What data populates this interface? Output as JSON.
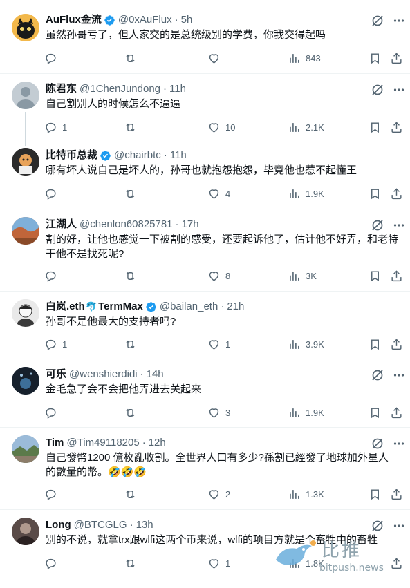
{
  "tweets": [
    {
      "name": "AuFlux金流",
      "handle": "@0xAuFlux",
      "time": "5h",
      "verified": true,
      "text": "虽然孙哥亏了，但人家交的是总统级别的学费，你我交得起吗",
      "reply": "",
      "retweet": "",
      "like": "",
      "views": "843",
      "avatar_color": "#f2b84b"
    },
    {
      "name": "陈君东",
      "handle": "@1ChenJundong",
      "time": "11h",
      "verified": false,
      "text": "自己割别人的时候怎么不逼逼",
      "reply": "1",
      "retweet": "",
      "like": "10",
      "views": "2.1K",
      "avatar_color": "#b8c4cc"
    },
    {
      "name": "比特币总裁",
      "handle": "@chairbtc",
      "time": "11h",
      "verified": true,
      "text": "哪有坏人说自己是坏人的，孙哥也就抱怨抱怨，毕竟他也惹不起懂王",
      "reply": "",
      "retweet": "",
      "like": "4",
      "views": "1.9K",
      "avatar_color": "#2a2a2a"
    },
    {
      "name": "江湖人",
      "handle": "@chenlon60825781",
      "time": "17h",
      "verified": false,
      "text": "割的好，让他也感觉一下被割的感受，还要起诉他了，估计他不好弄，和老特干他不是找死呢?",
      "reply": "",
      "retweet": "",
      "like": "8",
      "views": "3K",
      "avatar_color": "#c0653a"
    },
    {
      "name": "白岚.eth",
      "name_extra": "TermMax",
      "handle": "@bailan_eth",
      "time": "21h",
      "verified": true,
      "text": "孙哥不是他最大的支持者吗?",
      "reply": "1",
      "retweet": "",
      "like": "1",
      "views": "3.9K",
      "avatar_color": "#d8d8d8"
    },
    {
      "name": "可乐",
      "handle": "@wenshierdidi",
      "time": "14h",
      "verified": false,
      "text": "金毛急了会不会把他弄进去关起来",
      "reply": "",
      "retweet": "",
      "like": "3",
      "views": "1.9K",
      "avatar_color": "#1c2a3a"
    },
    {
      "name": "Tim",
      "handle": "@Tim49118205",
      "time": "12h",
      "verified": false,
      "text": "自己發幣1200 億枚亂收割。全世界人口有多少?孫割已經發了地球加外星人的數量的幣。🤣🤣🤣",
      "reply": "",
      "retweet": "",
      "like": "2",
      "views": "1.3K",
      "avatar_color": "#6b8fb0"
    },
    {
      "name": "Long",
      "handle": "@BTCGLG",
      "time": "13h",
      "verified": false,
      "text": "别的不说，就拿trx跟wlfi这两个币来说，wlfi的项目方就是个畜牲中的畜牲",
      "reply": "",
      "retweet": "",
      "like": "1",
      "views": "1.8K",
      "avatar_color": "#4a4040"
    }
  ],
  "watermark": {
    "title": "比推",
    "url": "bitpush.news"
  },
  "icons": {
    "reply": "reply-icon",
    "retweet": "retweet-icon",
    "like": "like-icon",
    "views": "views-icon",
    "bookmark": "bookmark-icon",
    "share": "share-icon",
    "grok": "grok-icon",
    "more": "more-icon",
    "verified": "verified-badge-icon"
  },
  "colors": {
    "text": "#0f1419",
    "secondary": "#536471",
    "verified": "#1d9bf0",
    "divider": "#eff3f4"
  }
}
